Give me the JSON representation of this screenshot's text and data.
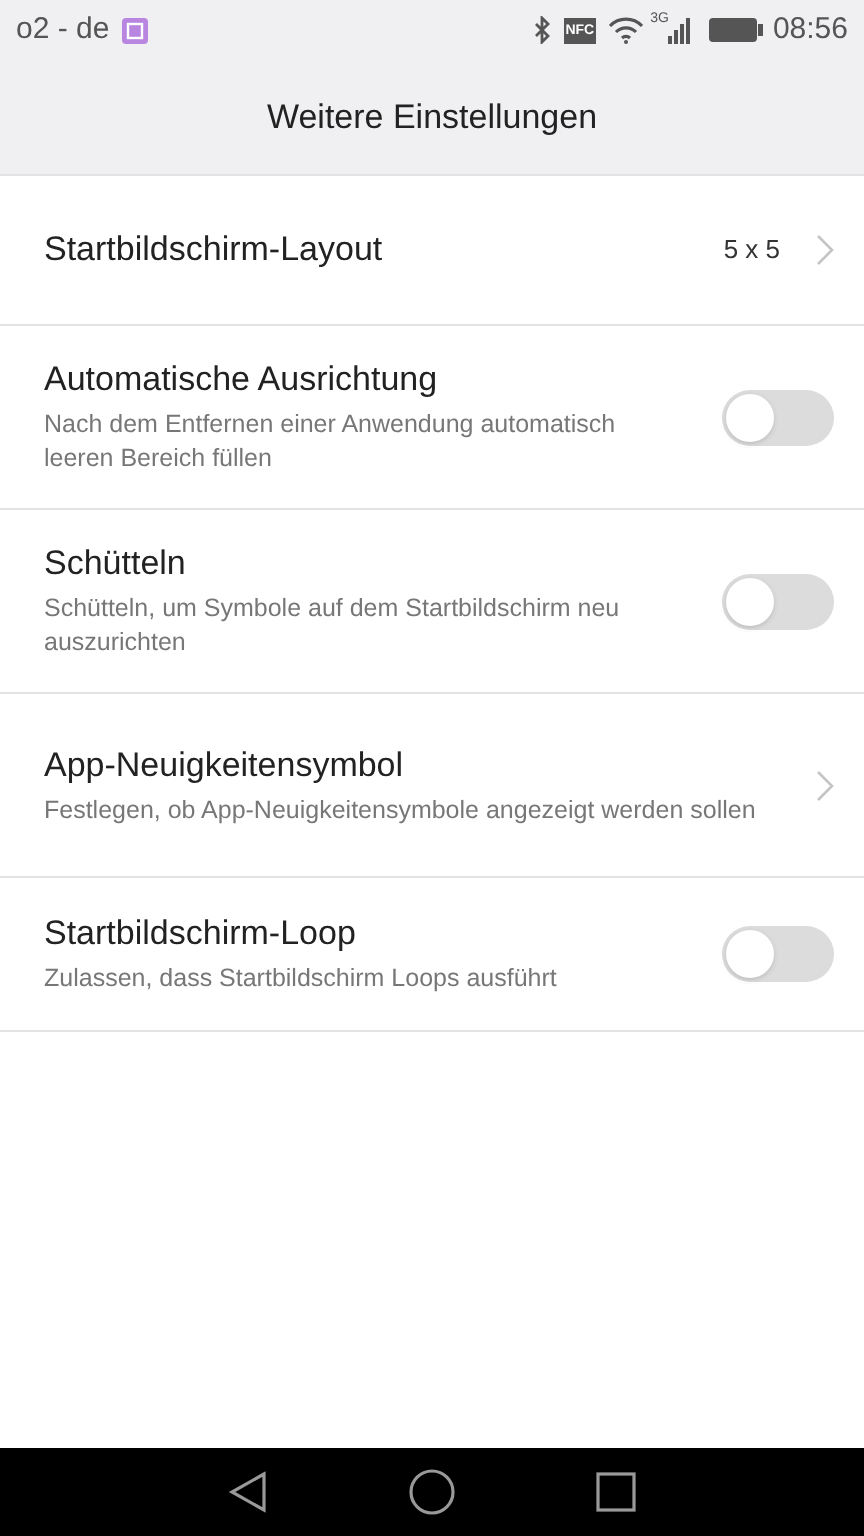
{
  "status_bar": {
    "carrier": "o2 - de",
    "nfc": "NFC",
    "network": "3G",
    "time": "08:56"
  },
  "header": {
    "title": "Weitere Einstellungen"
  },
  "items": [
    {
      "kind": "value",
      "title": "Startbildschirm-Layout",
      "value": "5 x 5"
    },
    {
      "kind": "toggle",
      "title": "Automatische Ausrichtung",
      "subtitle": "Nach dem Entfernen einer Anwendung automatisch leeren Bereich füllen",
      "on": false
    },
    {
      "kind": "toggle",
      "title": "Schütteln",
      "subtitle": "Schütteln, um Symbole auf dem Startbildschirm neu auszurichten",
      "on": false
    },
    {
      "kind": "link",
      "title": "App-Neuigkeitensymbol",
      "subtitle": "Festlegen, ob App-Neuigkeitensymbole angezeigt werden sollen"
    },
    {
      "kind": "toggle",
      "title": "Startbildschirm-Loop",
      "subtitle": "Zulassen, dass Startbildschirm Loops ausführt",
      "on": false
    }
  ]
}
